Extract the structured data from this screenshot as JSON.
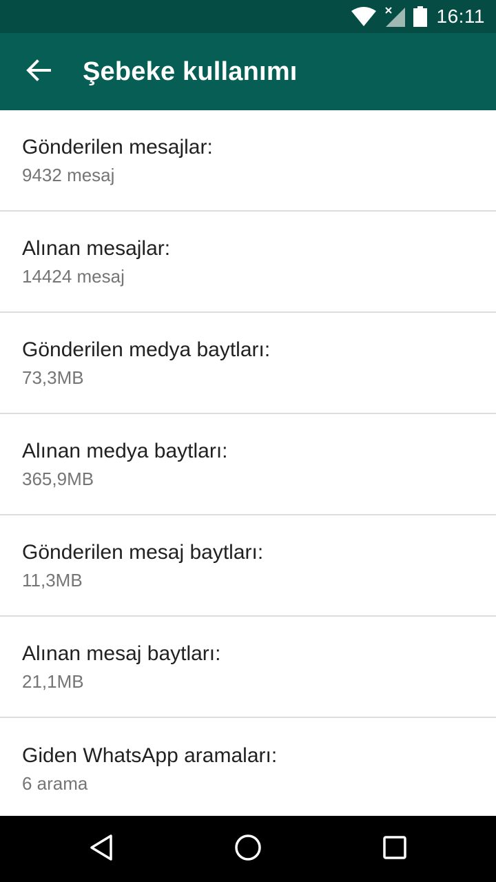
{
  "status_bar": {
    "time": "16:11",
    "icons": [
      "wifi-icon",
      "cellular-no-data-icon",
      "battery-icon"
    ]
  },
  "app_bar": {
    "back_icon": "arrow-left-icon",
    "title": "Şebeke kullanımı"
  },
  "items": [
    {
      "title": "Gönderilen mesajlar:",
      "value": "9432 mesaj"
    },
    {
      "title": "Alınan mesajlar:",
      "value": "14424 mesaj"
    },
    {
      "title": "Gönderilen medya baytları:",
      "value": "73,3MB"
    },
    {
      "title": "Alınan medya baytları:",
      "value": "365,9MB"
    },
    {
      "title": "Gönderilen mesaj baytları:",
      "value": "11,3MB"
    },
    {
      "title": "Alınan mesaj baytları:",
      "value": "21,1MB"
    },
    {
      "title": "Giden WhatsApp aramaları:",
      "value": "6 arama"
    }
  ],
  "nav_bar": {
    "buttons": [
      "back-triangle-icon",
      "home-circle-icon",
      "recents-square-icon"
    ]
  },
  "colors": {
    "status_bar": "#054d44",
    "app_bar": "#075e54",
    "title_text": "#212121",
    "secondary_text": "#757575"
  }
}
